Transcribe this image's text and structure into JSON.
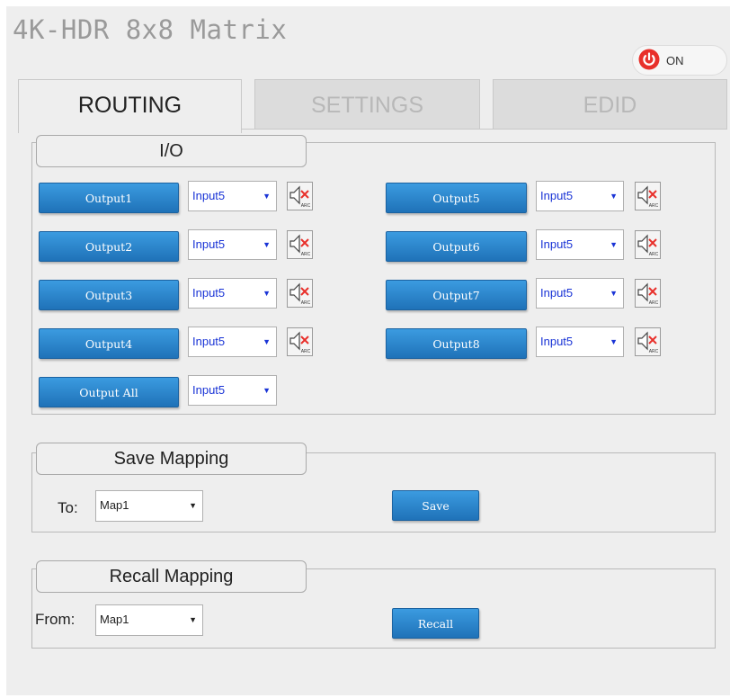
{
  "app": {
    "title": "4K-HDR 8x8 Matrix",
    "power_label": "ON"
  },
  "tabs": [
    {
      "label": "ROUTING",
      "active": true
    },
    {
      "label": "SETTINGS",
      "active": false
    },
    {
      "label": "EDID",
      "active": false
    }
  ],
  "io": {
    "legend": "I/O",
    "outputs": [
      {
        "label": "Output1",
        "input": "Input5"
      },
      {
        "label": "Output2",
        "input": "Input5"
      },
      {
        "label": "Output3",
        "input": "Input5"
      },
      {
        "label": "Output4",
        "input": "Input5"
      },
      {
        "label": "Output5",
        "input": "Input5"
      },
      {
        "label": "Output6",
        "input": "Input5"
      },
      {
        "label": "Output7",
        "input": "Input5"
      },
      {
        "label": "Output8",
        "input": "Input5"
      }
    ],
    "all": {
      "label": "Output All",
      "input": "Input5"
    },
    "arc_icon_text": "ARC"
  },
  "save_mapping": {
    "legend": "Save Mapping",
    "to_label": "To:",
    "map_value": "Map1",
    "button": "Save"
  },
  "recall_mapping": {
    "legend": "Recall Mapping",
    "from_label": "From:",
    "map_value": "Map1",
    "button": "Recall"
  },
  "colors": {
    "button": "#2a84cc",
    "power_red": "#e8302b",
    "mute_red": "#e8302b"
  }
}
